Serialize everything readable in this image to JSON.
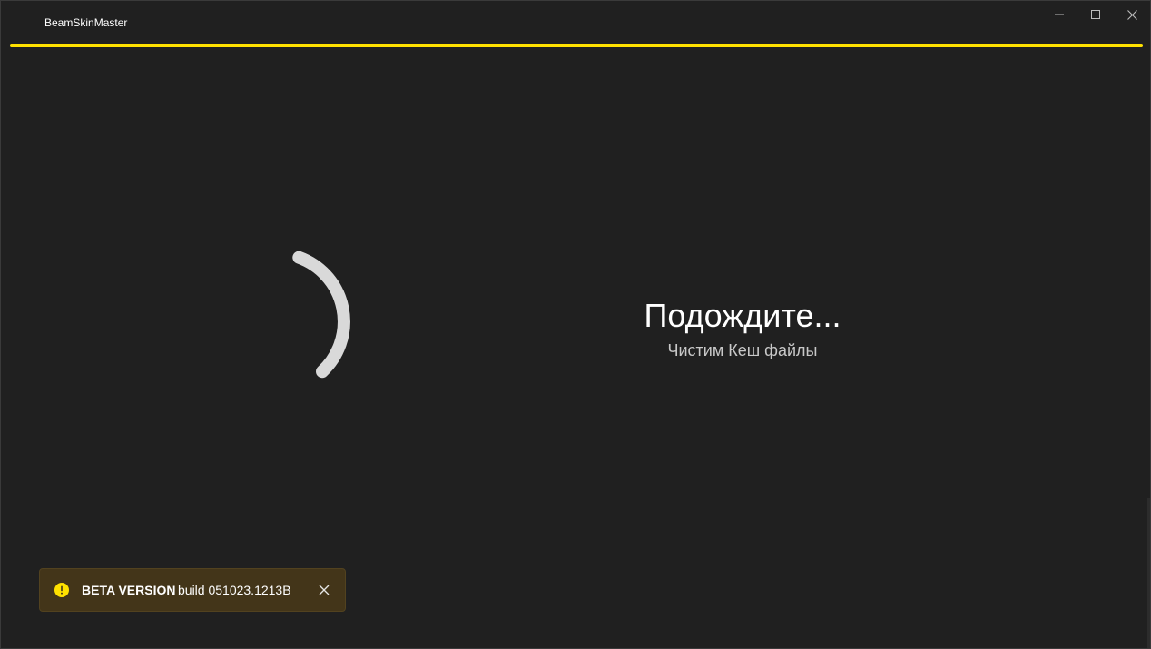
{
  "window": {
    "title": "BeamSkinMaster",
    "controls": {
      "minimize_icon": "minimize-icon",
      "maximize_icon": "maximize-icon",
      "close_icon": "close-icon"
    }
  },
  "progress": {
    "value": 1.0,
    "color": "#ffe100"
  },
  "spinner": {
    "icon": "loading-spinner-icon",
    "color": "#d9d9d9"
  },
  "status": {
    "title": "Подождите...",
    "subtitle": "Чистим Кеш файлы"
  },
  "infobar": {
    "icon": "warning-icon",
    "icon_color": "#ffe100",
    "title": "BETA VERSION",
    "message": "build 051023.1213B",
    "close_icon": "close-icon"
  }
}
